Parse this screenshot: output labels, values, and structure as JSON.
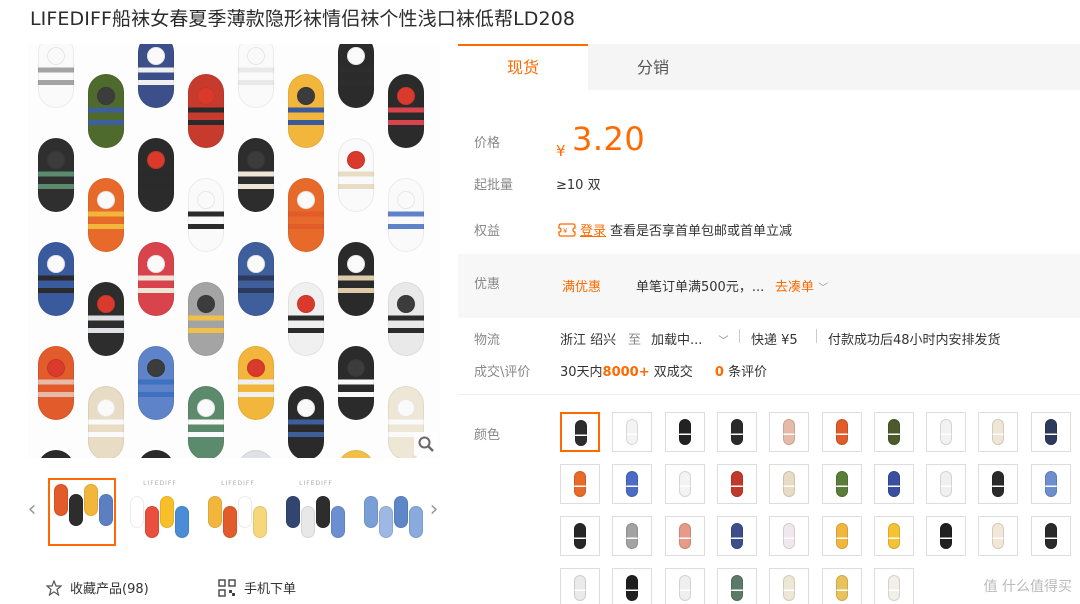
{
  "product": {
    "title": "LIFEDIFF船袜女春夏季薄款隐形袜情侣袜个性浅口袜低帮LD208"
  },
  "gallery": {
    "thumbnail_brand": "LIFEDIFF",
    "thumbnails": [
      {
        "colors": [
          "#e25b2a",
          "#2d2d2d",
          "#f2b63c",
          "#5c7fc2"
        ],
        "active": true
      },
      {
        "colors": [
          "#fff",
          "#e94f3c",
          "#f7c02b",
          "#4a8cd6"
        ]
      },
      {
        "colors": [
          "#f2b63c",
          "#e25b2a",
          "#fff",
          "#f7d77c"
        ]
      },
      {
        "colors": [
          "#31456e",
          "#e8e8e8",
          "#2d2d2d",
          "#6b8fd0"
        ]
      },
      {
        "colors": [
          "#7a9fd6",
          "#9db8e4",
          "#5f86c7",
          "#8aa9dc"
        ]
      }
    ]
  },
  "links": {
    "favorite": "收藏产品(98)",
    "mobile_order": "手机下单"
  },
  "tabs": [
    {
      "label": "现货",
      "active": true
    },
    {
      "label": "分销",
      "active": false
    }
  ],
  "price": {
    "label": "价格",
    "symbol": "¥",
    "value": "3.20"
  },
  "moq": {
    "label": "起批量",
    "value": "≥10 双"
  },
  "benefits": {
    "label": "权益",
    "icon": "coupon-icon",
    "login": "登录",
    "text": "查看是否享首单包邮或首单立减"
  },
  "promo": {
    "label": "优惠",
    "tag": "满优惠",
    "text": "单笔订单满500元，...",
    "action": "去凑单"
  },
  "shipping": {
    "label": "物流",
    "origin": "浙江 绍兴",
    "to": "至",
    "destination": "加载中...",
    "express": "快递 ¥5",
    "note": "付款成功后48小时内安排发货"
  },
  "deals": {
    "label": "成交\\评价",
    "prefix": "30天内",
    "count": "8000+",
    "suffix": "双成交",
    "reviews": "0",
    "reviews_suffix": "条评价"
  },
  "color": {
    "label": "颜色",
    "swatches": [
      {
        "c": "#2d2d2d",
        "selected": true
      },
      {
        "c": "#f4f4f4"
      },
      {
        "c": "#222222"
      },
      {
        "c": "#2b2b2b"
      },
      {
        "c": "#e7b9a8"
      },
      {
        "c": "#e25b2a"
      },
      {
        "c": "#4c5a2e"
      },
      {
        "c": "#f2f2f2"
      },
      {
        "c": "#efe6d6"
      },
      {
        "c": "#2e3a5c"
      },
      {
        "c": "#e86a2a"
      },
      {
        "c": "#4d6bc4"
      },
      {
        "c": "#f3f3f3"
      },
      {
        "c": "#c0392b"
      },
      {
        "c": "#e9dcc4"
      },
      {
        "c": "#5a7d3a"
      },
      {
        "c": "#3a4fa0"
      },
      {
        "c": "#f0f0f0"
      },
      {
        "c": "#2a2a2a"
      },
      {
        "c": "#6d8fcf"
      },
      {
        "c": "#262626"
      },
      {
        "c": "#a3a3a3"
      },
      {
        "c": "#e69a88"
      },
      {
        "c": "#3d4f8a"
      },
      {
        "c": "#f1e7ef"
      },
      {
        "c": "#f2b63c"
      },
      {
        "c": "#f5c233"
      },
      {
        "c": "#202020"
      },
      {
        "c": "#f3e8d8"
      },
      {
        "c": "#2a2a2a"
      },
      {
        "c": "#eaeaea"
      },
      {
        "c": "#1f1f1f"
      },
      {
        "c": "#efefef"
      },
      {
        "c": "#5b7a68"
      },
      {
        "c": "#efe7d6"
      },
      {
        "c": "#e8c25a"
      },
      {
        "c": "#f2efe8"
      }
    ]
  },
  "watermark": "值 什么值得买"
}
